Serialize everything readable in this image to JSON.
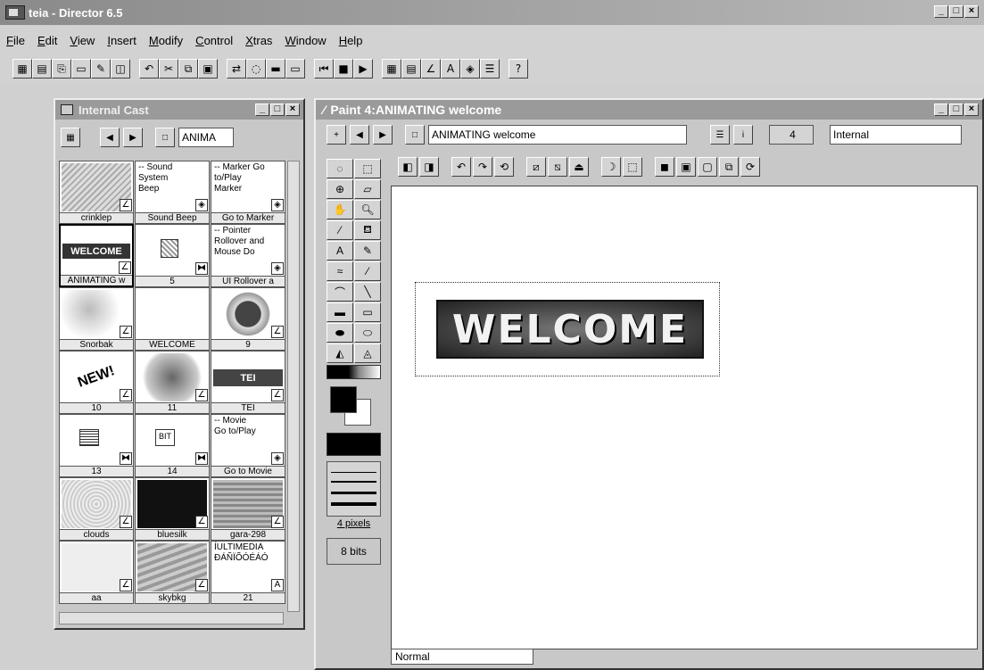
{
  "app": {
    "title": "teia - Director 6.5"
  },
  "menu": [
    "File",
    "Edit",
    "View",
    "Insert",
    "Modify",
    "Control",
    "Xtras",
    "Window",
    "Help"
  ],
  "cast": {
    "title": "Internal Cast",
    "name_field": "ANIMA",
    "members": [
      {
        "label": "crinklep",
        "text": ""
      },
      {
        "label": "Sound Beep",
        "text": "-- Sound\nSystem\nBeep"
      },
      {
        "label": "Go to Marker",
        "text": "-- Marker Go\nto/Play\nMarker"
      },
      {
        "label": "ANIMATING w",
        "text": "WELCOME"
      },
      {
        "label": "5",
        "text": ""
      },
      {
        "label": "UI Rollover a",
        "text": "-- Pointer\nRollover and\nMouse Do"
      },
      {
        "label": "Snorbak",
        "text": ""
      },
      {
        "label": "WELCOME",
        "text": ""
      },
      {
        "label": "9",
        "text": ""
      },
      {
        "label": "10",
        "text": "NEW!"
      },
      {
        "label": "11",
        "text": ""
      },
      {
        "label": "TEI",
        "text": "TEI"
      },
      {
        "label": "13",
        "text": ""
      },
      {
        "label": "14",
        "text": "BIT"
      },
      {
        "label": "Go to Movie",
        "text": "-- Movie\nGo to/Play"
      },
      {
        "label": "clouds",
        "text": ""
      },
      {
        "label": "bluesilk",
        "text": ""
      },
      {
        "label": "gara-298",
        "text": ""
      },
      {
        "label": "aa",
        "text": ""
      },
      {
        "label": "skybkg",
        "text": ""
      },
      {
        "label": "21",
        "text": "ÍULTIMEDIA\nÐÁÑÏÕÓÉÁÓ"
      }
    ]
  },
  "paint": {
    "title": "Paint 4:ANIMATING welcome",
    "member_name": "ANIMATING welcome",
    "member_num": "4",
    "cast_select": "Internal",
    "line_width": "4 pixels",
    "depth": "8 bits",
    "ink": "Normal",
    "welcome_text": "WELCOME"
  }
}
